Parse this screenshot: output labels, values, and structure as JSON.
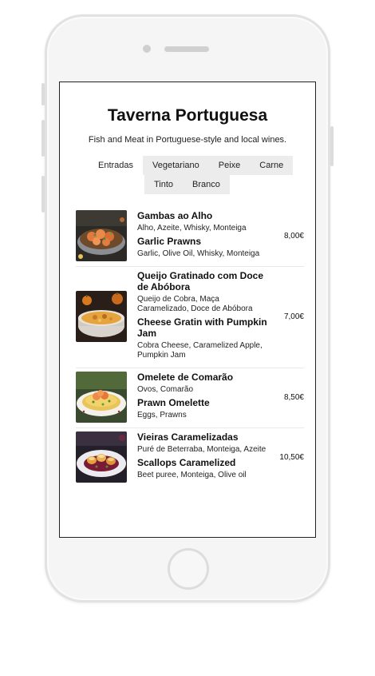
{
  "restaurant": {
    "title": "Taverna Portuguesa",
    "subtitle": "Fish and Meat in Portuguese-style and local wines."
  },
  "tabs": [
    {
      "label": "Entradas",
      "active": true
    },
    {
      "label": "Vegetariano",
      "active": false
    },
    {
      "label": "Peixe",
      "active": false
    },
    {
      "label": "Carne",
      "active": false
    },
    {
      "label": "Tinto",
      "active": false
    },
    {
      "label": "Branco",
      "active": false
    }
  ],
  "menu": {
    "items": [
      {
        "name_pt": "Gambas ao Alho",
        "desc_pt": "Alho, Azeite, Whisky, Monteiga",
        "name_en": "Garlic Prawns",
        "desc_en": "Garlic, Olive Oil, Whisky, Monteiga",
        "price": "8,00€",
        "image": "garlic-prawns-photo"
      },
      {
        "name_pt": "Queijo Gratinado com Doce de Abóbora",
        "desc_pt": "Queijo de Cobra, Maça Caramelizado, Doce de Abóbora",
        "name_en": "Cheese Gratin with Pumpkin Jam",
        "desc_en": "Cobra Cheese, Caramelized Apple, Pumpkin Jam",
        "price": "7,00€",
        "image": "cheese-gratin-photo"
      },
      {
        "name_pt": "Omelete de Comarão",
        "desc_pt": "Ovos, Comarão",
        "name_en": "Prawn Omelette",
        "desc_en": "Eggs, Prawns",
        "price": "8,50€",
        "image": "prawn-omelette-photo"
      },
      {
        "name_pt": "Vieiras Caramelizadas",
        "desc_pt": "Puré de Beterraba, Monteiga, Azeite",
        "name_en": "Scallops Caramelized",
        "desc_en": "Beet puree, Monteiga, Olive oil",
        "price": "10,50€",
        "image": "scallops-photo"
      }
    ]
  }
}
